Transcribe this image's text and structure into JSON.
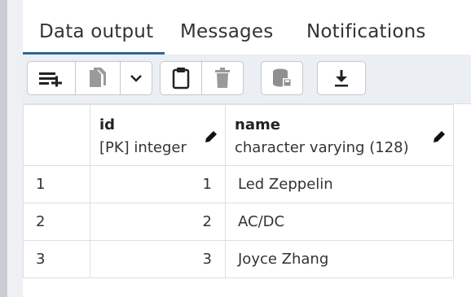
{
  "tabs": [
    {
      "label": "Data output",
      "active": true
    },
    {
      "label": "Messages",
      "active": false
    },
    {
      "label": "Notifications",
      "active": false
    }
  ],
  "toolbar": {
    "buttons": [
      {
        "icon": "add-row-icon"
      },
      {
        "icon": "copy-icon",
        "disabled": true
      },
      {
        "icon": "chevron-down-icon"
      },
      {
        "icon": "paste-icon"
      },
      {
        "icon": "delete-icon",
        "disabled": true
      },
      {
        "icon": "save-data-icon",
        "disabled": true
      },
      {
        "icon": "download-icon"
      }
    ]
  },
  "columns": [
    {
      "name": "id",
      "type": "[PK] integer"
    },
    {
      "name": "name",
      "type": "character varying (128)"
    }
  ],
  "rows": [
    {
      "num": "1",
      "id": "1",
      "name": "Led Zeppelin"
    },
    {
      "num": "2",
      "id": "2",
      "name": "AC/DC"
    },
    {
      "num": "3",
      "id": "3",
      "name": "Joyce Zhang"
    }
  ],
  "colors": {
    "accent": "#326690",
    "toolbar_bg": "#ebeef3",
    "border": "#dcdfe4"
  }
}
